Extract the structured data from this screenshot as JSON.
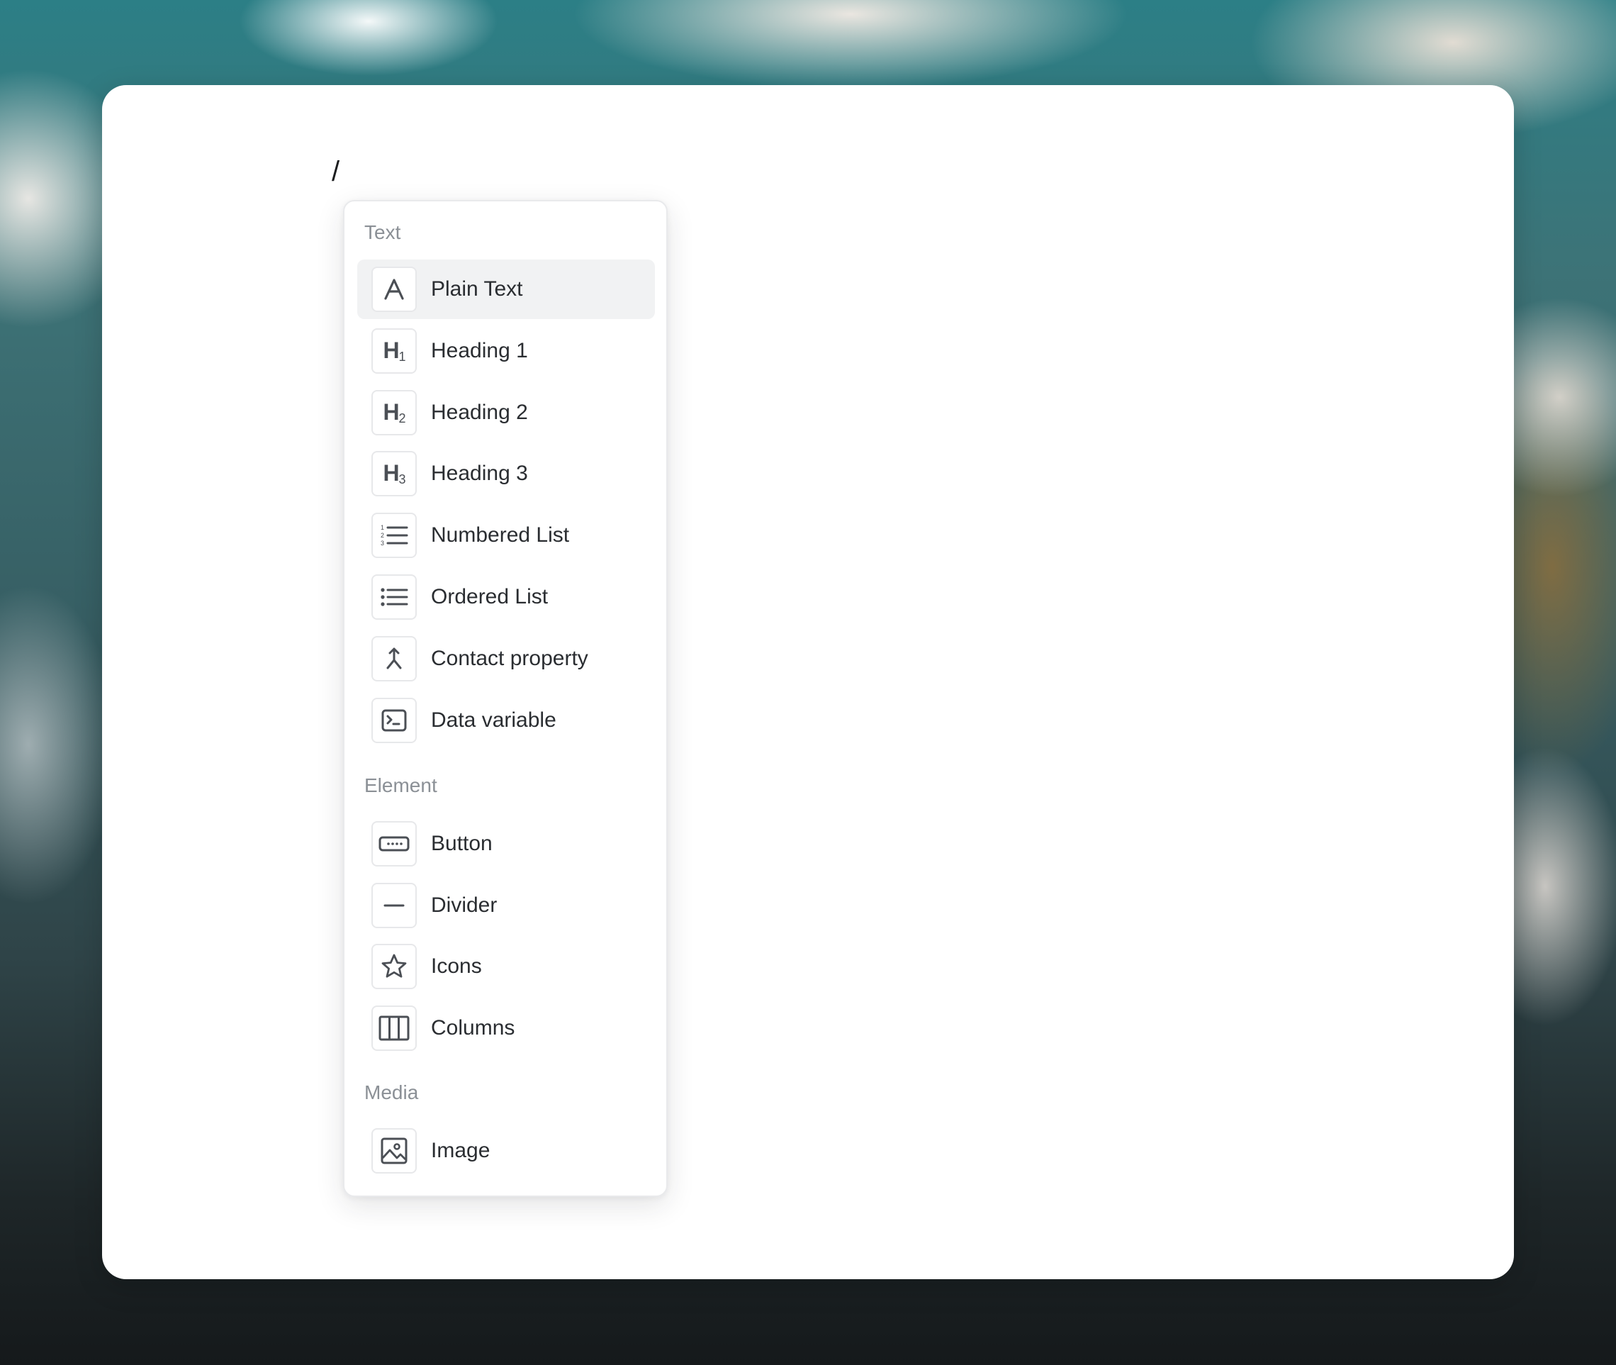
{
  "editor": {
    "typed_text": "/"
  },
  "menu": {
    "sections": [
      {
        "label": "Text",
        "items": [
          {
            "label": "Plain Text",
            "icon": "plain-text-icon",
            "active": true
          },
          {
            "label": "Heading 1",
            "icon": "heading-1-icon",
            "glyph": "H",
            "sub": "1"
          },
          {
            "label": "Heading 2",
            "icon": "heading-2-icon",
            "glyph": "H",
            "sub": "2"
          },
          {
            "label": "Heading 3",
            "icon": "heading-3-icon",
            "glyph": "H",
            "sub": "3"
          },
          {
            "label": "Numbered List",
            "icon": "numbered-list-icon"
          },
          {
            "label": "Ordered List",
            "icon": "bullet-list-icon"
          },
          {
            "label": "Contact property",
            "icon": "merge-icon"
          },
          {
            "label": "Data variable",
            "icon": "terminal-icon"
          }
        ]
      },
      {
        "label": "Element",
        "items": [
          {
            "label": "Button",
            "icon": "button-icon"
          },
          {
            "label": "Divider",
            "icon": "divider-icon"
          },
          {
            "label": "Icons",
            "icon": "star-icon"
          },
          {
            "label": "Columns",
            "icon": "columns-icon"
          }
        ]
      },
      {
        "label": "Media",
        "items": [
          {
            "label": "Image",
            "icon": "image-icon"
          }
        ]
      }
    ]
  },
  "colors": {
    "card": "#ffffff",
    "active_item_bg": "#f1f2f3",
    "section_label": "#8b9096",
    "item_text": "#2a2d31",
    "icon_stroke": "#4b4f55"
  }
}
